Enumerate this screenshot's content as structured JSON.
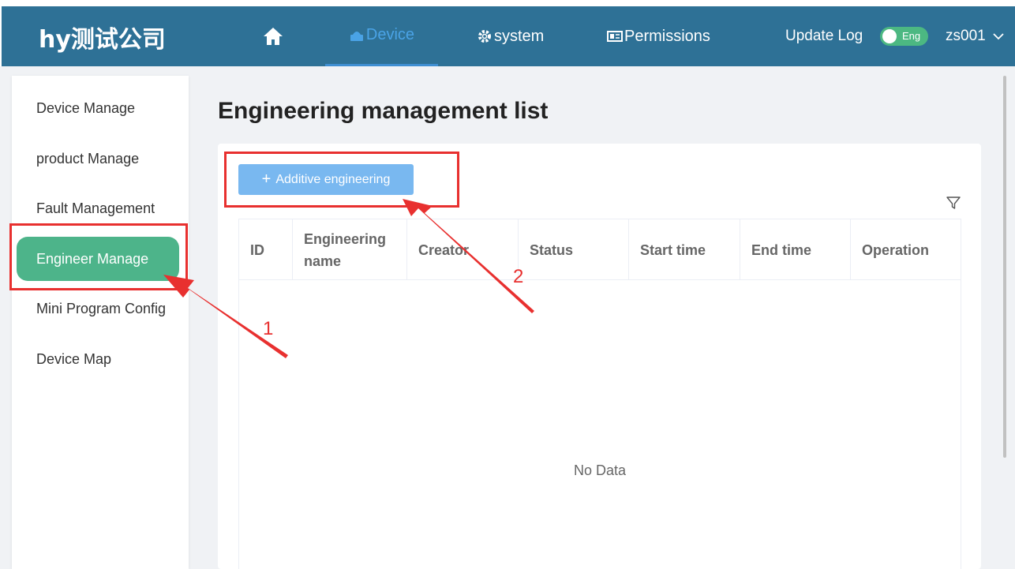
{
  "brand": "hy测试公司",
  "nav": {
    "home_icon": "home-icon",
    "device": "Device",
    "system": "system",
    "permissions": "Permissions",
    "update_log": "Update Log",
    "lang_toggle": "Eng",
    "user": "zs001"
  },
  "sidebar": {
    "items": [
      {
        "label": "Device Manage",
        "active": false
      },
      {
        "label": "product Manage",
        "active": false
      },
      {
        "label": "Fault Management",
        "active": false
      },
      {
        "label": "Engineer Manage",
        "active": true
      },
      {
        "label": "Mini Program Config",
        "active": false
      },
      {
        "label": "Device Map",
        "active": false
      }
    ]
  },
  "main": {
    "title": "Engineering management list",
    "add_button": "Additive engineering",
    "table": {
      "columns": [
        "ID",
        "Engineering name",
        "Creator",
        "Status",
        "Start time",
        "End time",
        "Operation"
      ],
      "rows": [],
      "empty_text": "No Data"
    }
  },
  "annotations": {
    "step1": "1",
    "step2": "2",
    "color": "#e8302f"
  },
  "colors": {
    "navbar": "#2e7196",
    "active_nav": "#4aa3e6",
    "sidebar_active": "#4db48a",
    "button": "#79b8f0"
  }
}
